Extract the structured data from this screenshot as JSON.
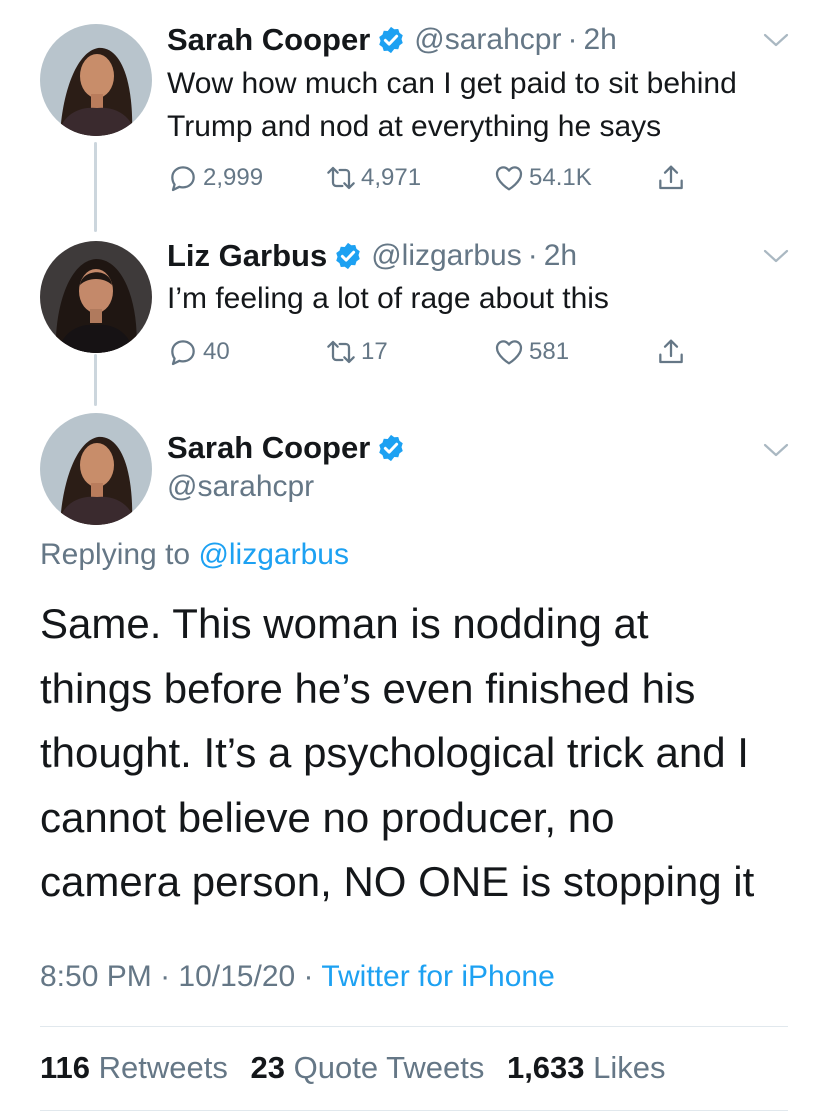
{
  "tweets": [
    {
      "name": "Sarah Cooper",
      "handle": "@sarahcpr",
      "dot": "·",
      "time": "2h",
      "text_line1": "Wow how much can I get paid to sit behind",
      "text_line2": "Trump and nod at everything he says",
      "replies": "2,999",
      "retweets": "4,971",
      "likes": "54.1K"
    },
    {
      "name": "Liz Garbus",
      "handle": "@lizgarbus",
      "dot": "·",
      "time": "2h",
      "text_line1": "I’m feeling a lot of rage about this",
      "replies": "40",
      "retweets": "17",
      "likes": "581"
    }
  ],
  "main": {
    "name": "Sarah Cooper",
    "handle": "@sarahcpr",
    "replying_prefix": "Replying to",
    "replying_to": "@lizgarbus",
    "text_lines": [
      "Same. This woman is nodding at",
      "things before he’s even finished his",
      "thought. It’s a psychological trick and I",
      "cannot believe no producer, no",
      "camera person, NO ONE is stopping it"
    ],
    "time": "8:50 PM",
    "dot": "·",
    "date": "10/15/20",
    "source": "Twitter for iPhone",
    "stats": {
      "retweets_count": "116",
      "retweets_label": "Retweets",
      "quotes_count": "23",
      "quotes_label": "Quote Tweets",
      "likes_count": "1,633",
      "likes_label": "Likes"
    }
  },
  "icons": {
    "verified": "verified-badge-icon",
    "reply": "reply-icon",
    "retweet": "retweet-icon",
    "like": "heart-icon",
    "share": "share-icon",
    "chevron": "chevron-down-icon"
  },
  "colors": {
    "accent": "#1da1f2",
    "secondary_text": "#657786",
    "thread_line": "#ccd6dd"
  }
}
